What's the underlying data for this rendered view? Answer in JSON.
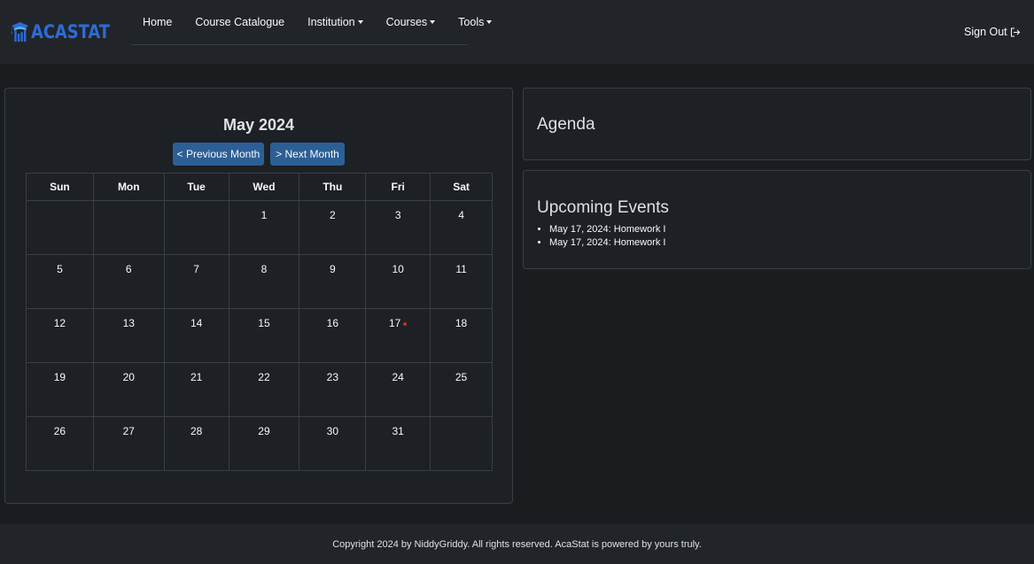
{
  "brand": {
    "name": "ACASTAT",
    "color": "#2d6bd8"
  },
  "nav": {
    "items": [
      {
        "label": "Home",
        "dropdown": false
      },
      {
        "label": "Course Catalogue",
        "dropdown": false
      },
      {
        "label": "Institution",
        "dropdown": true
      },
      {
        "label": "Courses",
        "dropdown": true
      },
      {
        "label": "Tools",
        "dropdown": true
      }
    ],
    "signout": "Sign Out"
  },
  "calendar": {
    "title": "May 2024",
    "prev_label": "< Previous Month",
    "next_label": "> Next Month",
    "weekdays": [
      "Sun",
      "Mon",
      "Tue",
      "Wed",
      "Thu",
      "Fri",
      "Sat"
    ],
    "weeks": [
      [
        "",
        "",
        "",
        "1",
        "2",
        "3",
        "4"
      ],
      [
        "5",
        "6",
        "7",
        "8",
        "9",
        "10",
        "11"
      ],
      [
        "12",
        "13",
        "14",
        "15",
        "16",
        "17",
        "18"
      ],
      [
        "19",
        "20",
        "21",
        "22",
        "23",
        "24",
        "25"
      ],
      [
        "26",
        "27",
        "28",
        "29",
        "30",
        "31",
        ""
      ]
    ],
    "event_days": [
      "17"
    ],
    "event_dot_color": "#d9261c"
  },
  "agenda": {
    "title": "Agenda"
  },
  "upcoming": {
    "title": "Upcoming Events",
    "events": [
      "May 17, 2024: Homework I",
      "May 17, 2024: Homework I"
    ]
  },
  "footer": {
    "text": "Copyright 2024 by NiddyGriddy. All rights reserved. AcaStat is powered by yours truly."
  },
  "colors": {
    "accent_button": "#2c5f96",
    "background": "#1a1d20",
    "navbar": "#212529"
  }
}
